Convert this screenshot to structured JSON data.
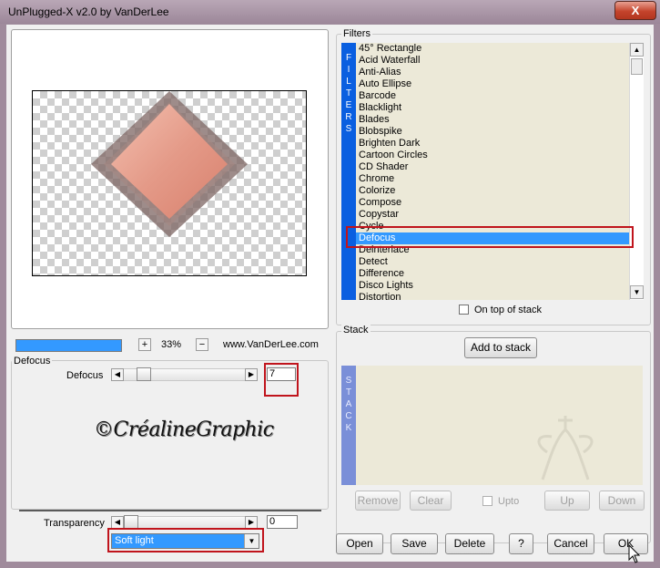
{
  "window": {
    "title": "UnPlugged-X v2.0 by VanDerLee",
    "close_label": "X"
  },
  "preview": {
    "zoom_value": "33%",
    "zoom_plus": "+",
    "zoom_minus": "−",
    "website": "www.VanDerLee.com"
  },
  "filters": {
    "group_label": "Filters",
    "side_label": "FILTERS",
    "items": [
      "45° Rectangle",
      "Acid Waterfall",
      "Anti-Alias",
      "Auto Ellipse",
      "Barcode",
      "Blacklight",
      "Blades",
      "Blobspike",
      "Brighten Dark",
      "Cartoon Circles",
      "CD Shader",
      "Chrome",
      "Colorize",
      "Compose",
      "Copystar",
      "Cycle",
      "Defocus",
      "Deinterlace",
      "Detect",
      "Difference",
      "Disco Lights",
      "Distortion"
    ],
    "selected": "Defocus",
    "on_top_label": "On top of stack"
  },
  "stack": {
    "group_label": "Stack",
    "side_label": "STACK",
    "add_button": "Add to stack",
    "remove_button": "Remove",
    "clear_button": "Clear",
    "upto_label": "Upto",
    "up_button": "Up",
    "down_button": "Down"
  },
  "params": {
    "group_label": "Defocus",
    "slider_label": "Defocus",
    "slider_value": "7",
    "slider_level": 0.12,
    "transparency_label": "Transparency",
    "transparency_value": "0",
    "transparency_level": 0.0,
    "blend_mode": "Soft light"
  },
  "watermark": "©CréalineGraphic",
  "footer": {
    "open": "Open",
    "save": "Save",
    "delete": "Delete",
    "help": "?",
    "cancel": "Cancel",
    "ok": "OK"
  },
  "colors": {
    "accent": "#3399ff",
    "highlight_box": "#c0141c",
    "title_bar": "#a08b9c",
    "side_band": "#0a5fe0"
  }
}
